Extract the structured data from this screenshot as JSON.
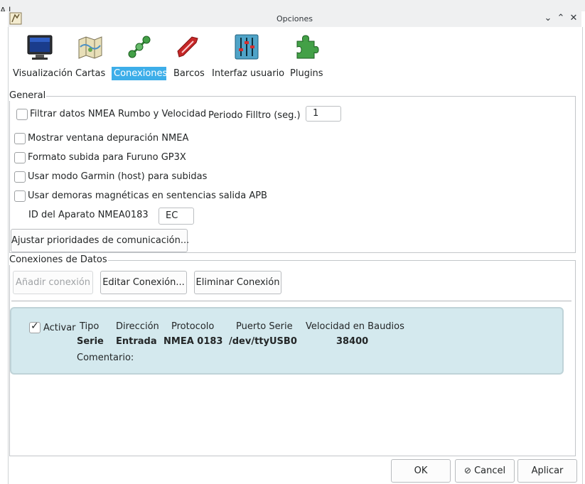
{
  "window": {
    "title": "Opciones",
    "behind_text": "A   l"
  },
  "tabs": [
    {
      "label": "Visualización",
      "icon": "monitor-icon"
    },
    {
      "label": "Cartas",
      "icon": "charts-map-icon"
    },
    {
      "label": "Conexiones",
      "icon": "connections-icon",
      "active": true
    },
    {
      "label": "Barcos",
      "icon": "boat-icon"
    },
    {
      "label": "Interfaz usuario",
      "icon": "sliders-icon"
    },
    {
      "label": "Plugins",
      "icon": "puzzle-icon"
    }
  ],
  "general": {
    "legend": "General",
    "filter_nmea": "Filtrar datos NMEA Rumbo y Velocidad",
    "filter_period_label": "Periodo Filltro (seg.)",
    "filter_period_value": "1",
    "debug_window": "Mostrar ventana depuración NMEA",
    "furuno": "Formato subida para Furuno GP3X",
    "garmin": "Usar modo Garmin (host) para subidas",
    "apb": "Usar demoras magnéticas en sentencias salida APB",
    "device_id_label": "ID del Aparato NMEA0183",
    "device_id_value": "EC",
    "priorities_button": "Ajustar prioridades de comunicación..."
  },
  "data_connections": {
    "legend": "Conexiones de Datos",
    "add_button": "Añadir conexión",
    "edit_button": "Editar Conexión...",
    "delete_button": "Eliminar Conexión",
    "connection": {
      "enable_label": "Activar",
      "enabled": true,
      "headers": {
        "type": "Tipo",
        "direction": "Dirección",
        "protocol": "Protocolo",
        "port": "Puerto Serie",
        "baud": "Velocidad en Baudios"
      },
      "values": {
        "type": "Serie",
        "direction": "Entrada",
        "protocol": "NMEA 0183",
        "port": "/dev/ttyUSB0",
        "baud": "38400"
      },
      "comment_label": "Comentario:"
    }
  },
  "footer": {
    "ok": "OK",
    "cancel": "Cancel",
    "apply": "Aplicar"
  }
}
